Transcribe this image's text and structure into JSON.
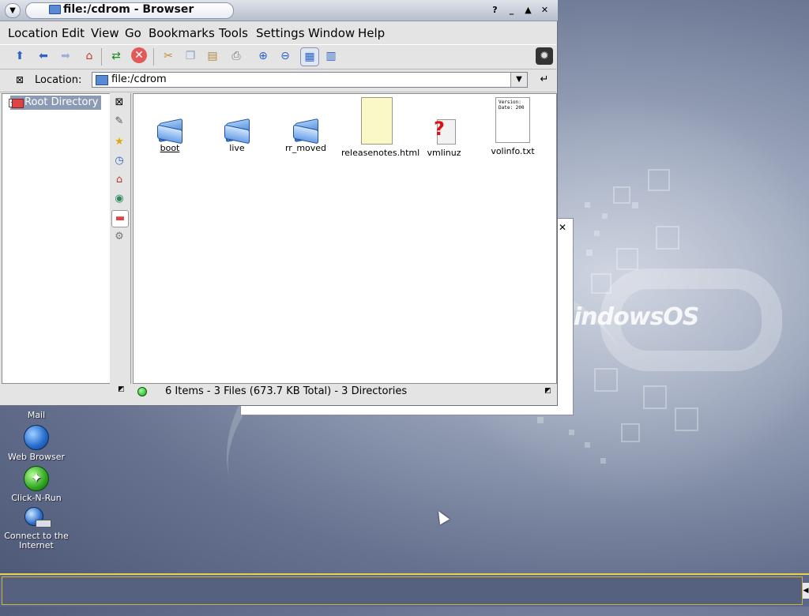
{
  "window": {
    "title": "file:/cdrom - Browser",
    "controls": [
      "?",
      "_",
      "▲",
      "✕"
    ]
  },
  "menu": [
    "Location",
    "Edit",
    "View",
    "Go",
    "Bookmarks",
    "Tools",
    "Settings",
    "Window",
    "Help"
  ],
  "location": {
    "label": "Location:",
    "value": "file:/cdrom"
  },
  "tree": {
    "root": "Root Directory"
  },
  "files": [
    {
      "name": "boot",
      "type": "folder"
    },
    {
      "name": "live",
      "type": "folder"
    },
    {
      "name": "rr_moved",
      "type": "folder"
    },
    {
      "name": "releasenotes.html",
      "type": "html"
    },
    {
      "name": "vmlinuz",
      "type": "unknown"
    },
    {
      "name": "volinfo.txt",
      "type": "text",
      "preview": "Version:\nDate: 200"
    }
  ],
  "status": "6 Items - 3 Files (673.7 KB Total) - 3 Directories",
  "desktop_icons": [
    {
      "label": "Mail",
      "icon": "mail-icon"
    },
    {
      "label": "Web Browser",
      "icon": "globe-icon"
    },
    {
      "label": "Click-N-Run",
      "icon": "click-n-run-icon"
    },
    {
      "label": "Connect to the Internet",
      "icon": "connect-internet-icon"
    }
  ],
  "brand_text": "indowsOS",
  "colors": {
    "desktop": "#66728f",
    "panel": "#5b6688",
    "panel_border": "#e8d24a",
    "tree_selection": "#8c9bb4",
    "status_ok": "#1c9b1c"
  }
}
